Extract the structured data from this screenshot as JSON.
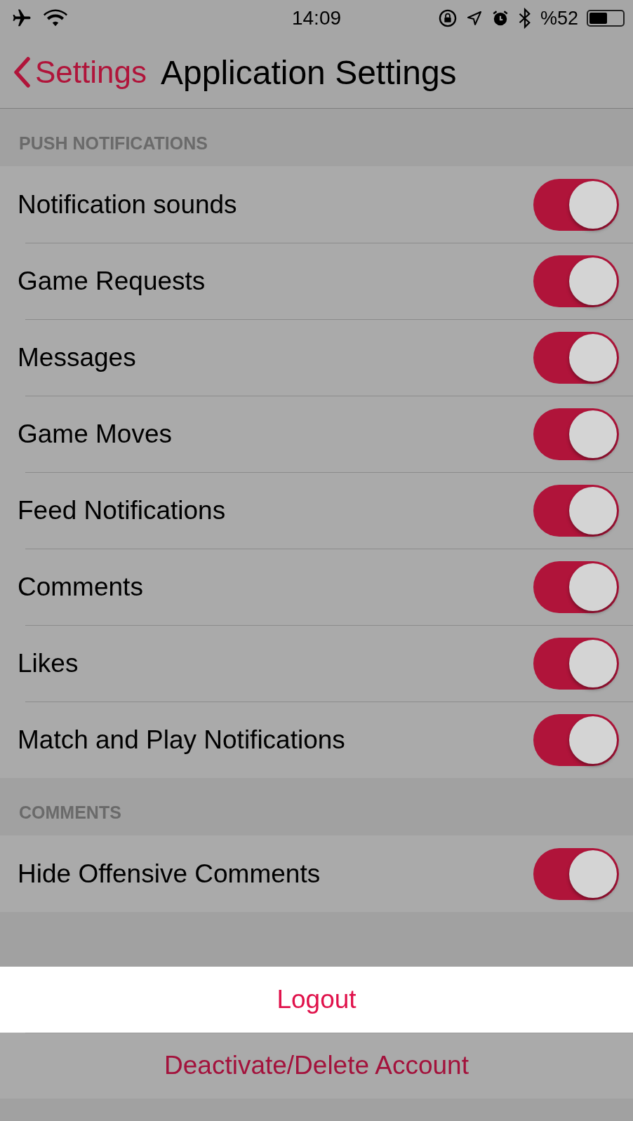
{
  "status_bar": {
    "time": "14:09",
    "battery_text": "%52"
  },
  "nav": {
    "back_label": "Settings",
    "title": "Application Settings"
  },
  "sections": [
    {
      "header": "PUSH NOTIFICATIONS",
      "rows": [
        {
          "label": "Notification sounds",
          "on": true
        },
        {
          "label": "Game Requests",
          "on": true
        },
        {
          "label": "Messages",
          "on": true
        },
        {
          "label": "Game Moves",
          "on": true
        },
        {
          "label": "Feed Notifications",
          "on": true
        },
        {
          "label": "Comments",
          "on": true
        },
        {
          "label": "Likes",
          "on": true
        },
        {
          "label": "Match and Play Notifications",
          "on": true
        }
      ]
    },
    {
      "header": "COMMENTS",
      "rows": [
        {
          "label": "Hide Offensive Comments",
          "on": true
        }
      ]
    }
  ],
  "actions": [
    {
      "label": "Logout",
      "highlighted": true
    },
    {
      "label": "Deactivate/Delete Account",
      "highlighted": false
    }
  ]
}
